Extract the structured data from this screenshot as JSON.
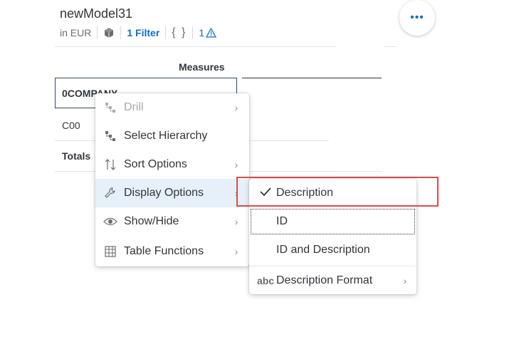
{
  "header": {
    "title": "newModel31",
    "currency": "in EUR",
    "filter_label": "1 Filter",
    "braces": "{ }",
    "warning_count": "1",
    "more_label": "•••"
  },
  "table": {
    "measures_header": "Measures",
    "dimension_header": "0COMPANY",
    "rows": [
      "C00"
    ],
    "totals_label": "Totals"
  },
  "context_menu": {
    "items": [
      {
        "label": "Drill",
        "icon": "drill-hierarchy-icon",
        "disabled": true,
        "submenu": true
      },
      {
        "label": "Select Hierarchy",
        "icon": "hierarchy-icon",
        "disabled": false,
        "submenu": false
      },
      {
        "label": "Sort Options",
        "icon": "sort-icon",
        "disabled": false,
        "submenu": true
      },
      {
        "label": "Display Options",
        "icon": "wrench-icon",
        "disabled": false,
        "submenu": true,
        "selected": true
      },
      {
        "label": "Show/Hide",
        "icon": "eye-icon",
        "disabled": false,
        "submenu": true
      },
      {
        "label": "Table Functions",
        "icon": "table-icon",
        "disabled": false,
        "submenu": true
      }
    ]
  },
  "display_submenu": {
    "items": [
      {
        "label": "Description",
        "checked": true,
        "icon": "checkmark-icon"
      },
      {
        "label": "ID",
        "checked": false
      },
      {
        "label": "ID and Description",
        "checked": false
      },
      {
        "label": "Description Format",
        "icon_text": "abc",
        "submenu": true
      }
    ]
  },
  "colors": {
    "accent": "#0a6ed1",
    "highlight_border": "#e04a4a",
    "selected_bg": "#e5f0fa"
  }
}
